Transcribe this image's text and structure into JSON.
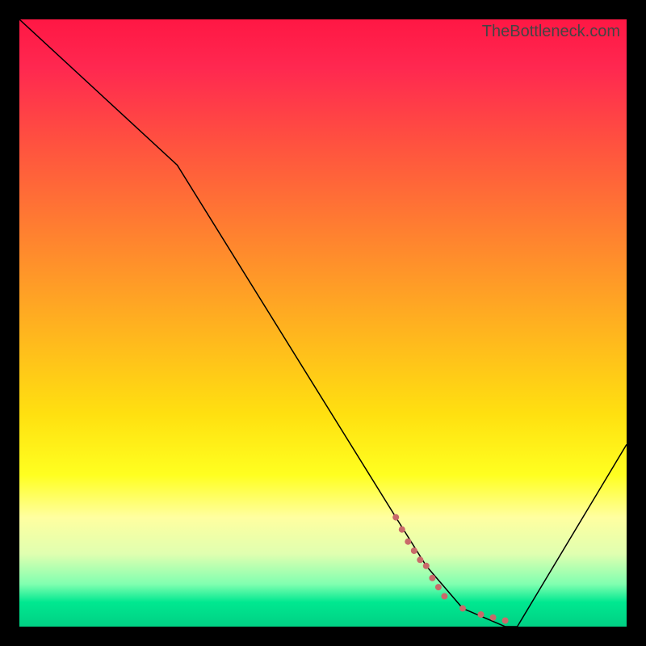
{
  "watermark": "TheBottleneck.com",
  "chart_data": {
    "type": "line",
    "title": "",
    "xlabel": "",
    "ylabel": "",
    "xlim": [
      0,
      100
    ],
    "ylim": [
      0,
      100
    ],
    "series": [
      {
        "name": "curve",
        "x": [
          0,
          26,
          62,
          67,
          73,
          80,
          82,
          100
        ],
        "y": [
          100,
          76,
          18,
          10,
          3,
          0,
          0,
          30
        ],
        "color": "#000000",
        "stroke_width": 1.5
      },
      {
        "name": "highlight-dots",
        "x": [
          62,
          63,
          64,
          65,
          66,
          67,
          68,
          69,
          70,
          73,
          76,
          78,
          80
        ],
        "y": [
          18,
          16,
          14,
          12.5,
          11,
          10,
          8,
          6.5,
          5,
          3,
          2,
          1.5,
          1
        ],
        "color": "#c96a6a",
        "marker": "dot",
        "marker_size": 8
      }
    ],
    "background": {
      "type": "vertical-gradient",
      "stops": [
        {
          "pos": 0.0,
          "color": "#ff1744"
        },
        {
          "pos": 0.5,
          "color": "#ffb020"
        },
        {
          "pos": 0.8,
          "color": "#ffff50"
        },
        {
          "pos": 0.96,
          "color": "#00e890"
        },
        {
          "pos": 1.0,
          "color": "#00d084"
        }
      ]
    }
  }
}
